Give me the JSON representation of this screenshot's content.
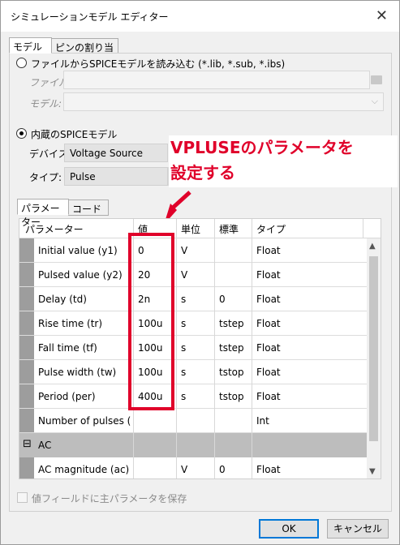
{
  "window": {
    "title": "シミュレーションモデル エディター",
    "close_glyph": "✕"
  },
  "tabs": [
    {
      "label": "モデル"
    },
    {
      "label": "ピンの割り当て"
    }
  ],
  "source": {
    "file_option_label": "ファイルからSPICEモデルを読み込む (*.lib, *.sub, *.ibs)",
    "file_label": "ファイル:",
    "model_label": "モデル:",
    "builtin_option_label": "内蔵のSPICEモデル",
    "device_label": "デバイス:",
    "device_value": "Voltage Source",
    "type_label": "タイプ:",
    "type_value": "Pulse"
  },
  "annotation": {
    "line1": "VPLUSEのパラメータを",
    "line2": "設定する",
    "color": "#e0002a"
  },
  "subtabs": [
    {
      "label": "パラメーター"
    },
    {
      "label": "コード"
    }
  ],
  "table": {
    "headers": {
      "param": "パラメーター",
      "value": "値",
      "unit": "単位",
      "standard": "標準",
      "type": "タイプ"
    },
    "rows": [
      {
        "param": "Initial value (y1)",
        "value": "0",
        "unit": "V",
        "standard": "",
        "type": "Float"
      },
      {
        "param": "Pulsed value (y2)",
        "value": "20",
        "unit": "V",
        "standard": "",
        "type": "Float"
      },
      {
        "param": "Delay (td)",
        "value": "2n",
        "unit": "s",
        "standard": "0",
        "type": "Float"
      },
      {
        "param": "Rise time (tr)",
        "value": "100u",
        "unit": "s",
        "standard": "tstep",
        "type": "Float"
      },
      {
        "param": "Fall time (tf)",
        "value": "100u",
        "unit": "s",
        "standard": "tstep",
        "type": "Float"
      },
      {
        "param": "Pulse width (tw)",
        "value": "100u",
        "unit": "s",
        "standard": "tstop",
        "type": "Float"
      },
      {
        "param": "Period (per)",
        "value": "400u",
        "unit": "s",
        "standard": "tstop",
        "type": "Float"
      },
      {
        "param": "Number of pulses (np",
        "value": "",
        "unit": "",
        "standard": "",
        "type": "Int"
      }
    ],
    "group": {
      "toggle": "⊟",
      "label": "AC"
    },
    "ac_row": {
      "param": "AC magnitude (ac)",
      "value": "",
      "unit": "V",
      "standard": "0",
      "type": "Float"
    }
  },
  "footer": {
    "save_checkbox_label": "値フィールドに主パラメータを保存",
    "ok_label": "OK",
    "cancel_label": "キャンセル"
  }
}
